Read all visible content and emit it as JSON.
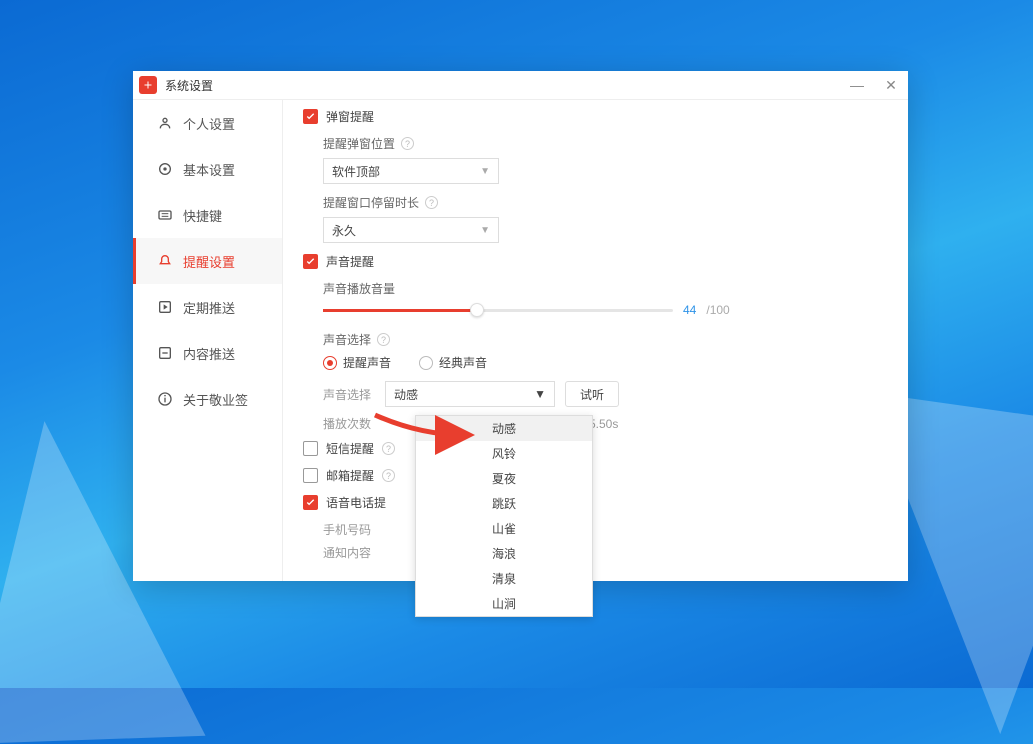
{
  "window": {
    "title": "系统设置"
  },
  "sidebar": {
    "items": [
      {
        "label": "个人设置"
      },
      {
        "label": "基本设置"
      },
      {
        "label": "快捷键"
      },
      {
        "label": "提醒设置"
      },
      {
        "label": "定期推送"
      },
      {
        "label": "内容推送"
      },
      {
        "label": "关于敬业签"
      }
    ]
  },
  "popup": {
    "chk_label": "弹窗提醒",
    "pos_label": "提醒弹窗位置",
    "pos_value": "软件顶部",
    "dur_label": "提醒窗口停留时长",
    "dur_value": "永久"
  },
  "sound": {
    "chk_label": "声音提醒",
    "vol_label": "声音播放音量",
    "vol_value": "44",
    "vol_max": "/100",
    "choice_label": "声音选择",
    "radio_remind": "提醒声音",
    "radio_classic": "经典声音",
    "select_label": "声音选择",
    "select_value": "动感",
    "listen_btn": "试听",
    "play_count_label": "播放次数",
    "duration_suffix": "时长5.50s"
  },
  "sms": {
    "label": "短信提醒"
  },
  "mail": {
    "label": "邮箱提醒"
  },
  "voice": {
    "label": "语音电话提",
    "phone_label": "手机号码",
    "content_label": "通知内容"
  },
  "dropdown": {
    "options": [
      "动感",
      "风铃",
      "夏夜",
      "跳跃",
      "山雀",
      "海浪",
      "清泉",
      "山涧"
    ]
  }
}
